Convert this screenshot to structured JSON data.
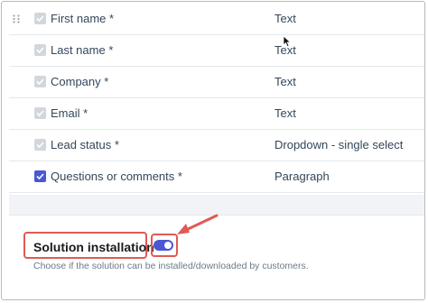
{
  "fields": [
    {
      "name": "First name *",
      "type": "Text",
      "checked": true,
      "editable": false
    },
    {
      "name": "Last name *",
      "type": "Text",
      "checked": true,
      "editable": false
    },
    {
      "name": "Company *",
      "type": "Text",
      "checked": true,
      "editable": false
    },
    {
      "name": "Email *",
      "type": "Text",
      "checked": true,
      "editable": false
    },
    {
      "name": "Lead status *",
      "type": "Dropdown - single select",
      "checked": true,
      "editable": false
    },
    {
      "name": "Questions or comments *",
      "type": "Paragraph",
      "checked": true,
      "editable": true
    }
  ],
  "solution_installation": {
    "label": "Solution installation",
    "description": "Choose if the solution can be installed/downloaded by customers.",
    "enabled": true
  },
  "colors": {
    "accent": "#4a58d1",
    "highlight": "#e05a55",
    "disabled_checkbox": "#d3d7dc"
  },
  "icons": {
    "drag": "drag-handle-icon",
    "check": "checkmark-icon",
    "cursor": "mouse-pointer-icon",
    "arrow": "annotation-arrow-icon"
  }
}
